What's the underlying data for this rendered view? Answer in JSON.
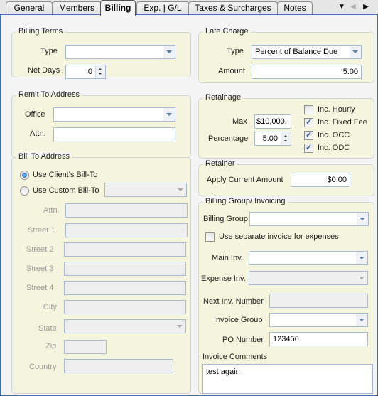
{
  "tabs": [
    {
      "label": "General",
      "active": false
    },
    {
      "label": "Members",
      "active": false
    },
    {
      "label": "Billing",
      "active": true
    },
    {
      "label": "Exp. | G/L",
      "active": false
    },
    {
      "label": "Taxes & Surcharges",
      "active": false
    },
    {
      "label": "Notes",
      "active": false
    }
  ],
  "tab_controls": {
    "menu_icon": "▼",
    "prev_icon": "◀",
    "next_icon": "▶"
  },
  "billing_terms": {
    "title": "Billing Terms",
    "type_label": "Type",
    "type_value": "",
    "net_days_label": "Net Days",
    "net_days_value": "0"
  },
  "remit_to": {
    "title": "Remit To Address",
    "office_label": "Office",
    "office_value": "",
    "attn_label": "Attn.",
    "attn_value": ""
  },
  "bill_to": {
    "title": "Bill To Address",
    "use_client_label": "Use Client's Bill-To",
    "use_client_selected": true,
    "use_custom_label": "Use Custom Bill-To",
    "use_custom_selected": false,
    "custom_value": "",
    "attn_label": "Attn.",
    "street1_label": "Street 1",
    "street2_label": "Street 2",
    "street3_label": "Street 3",
    "street4_label": "Street 4",
    "city_label": "City",
    "state_label": "State",
    "zip_label": "Zip",
    "country_label": "Country"
  },
  "late_charge": {
    "title": "Late Charge",
    "type_label": "Type",
    "type_value": "Percent of Balance Due",
    "amount_label": "Amount",
    "amount_value": "5.00"
  },
  "retainage": {
    "title": "Retainage",
    "max_label": "Max",
    "max_value": "$10,000.",
    "percentage_label": "Percentage",
    "percentage_value": "5.00",
    "inc_hourly_label": "Inc. Hourly",
    "inc_hourly_checked": false,
    "inc_fixed_fee_label": "Inc. Fixed Fee",
    "inc_fixed_fee_checked": true,
    "inc_occ_label": "Inc. OCC",
    "inc_occ_checked": true,
    "inc_odc_label": "Inc. ODC",
    "inc_odc_checked": true
  },
  "retainer": {
    "title": "Retainer",
    "apply_label": "Apply Current Amount",
    "apply_value": "$0.00"
  },
  "billing_group": {
    "title": "Billing Group/ Invoicing",
    "billing_group_label": "Billing Group",
    "billing_group_value": "",
    "separate_invoice_label": "Use separate invoice for expenses",
    "separate_invoice_checked": false,
    "main_inv_label": "Main Inv.",
    "main_inv_value": "",
    "expense_inv_label": "Expense Inv.",
    "expense_inv_value": "",
    "next_inv_label": "Next Inv. Number",
    "next_inv_value": "",
    "invoice_group_label": "Invoice Group",
    "invoice_group_value": "",
    "po_number_label": "PO Number",
    "po_number_value": "123456",
    "invoice_comments_label": "Invoice Comments",
    "invoice_comments_value": "test again"
  }
}
